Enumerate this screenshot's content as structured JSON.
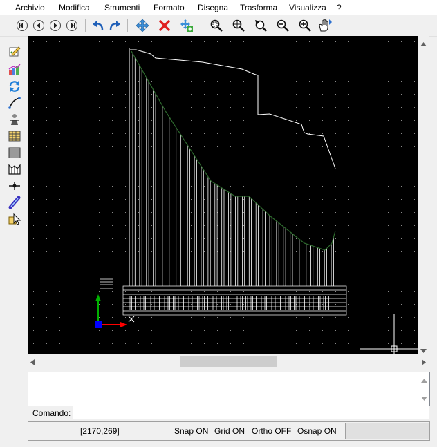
{
  "menu": [
    "Archivio",
    "Modifica",
    "Strumenti",
    "Formato",
    "Disegna",
    "Trasforma",
    "Visualizza",
    "?"
  ],
  "toolbar": {
    "icons": [
      "first-icon",
      "prev-icon",
      "next-icon",
      "last-icon",
      "undo-icon",
      "redo-icon",
      "move-icon",
      "delete-icon",
      "copy-move-icon",
      "zoom-window-icon",
      "zoom-extents-icon",
      "zoom-previous-icon",
      "zoom-out-icon",
      "zoom-in-icon",
      "pan-icon"
    ]
  },
  "sidebar": {
    "icons": [
      "edit-icon",
      "chart-icon",
      "refresh-icon",
      "curve-icon",
      "figure-icon",
      "table-icon",
      "list-icon",
      "section-icon",
      "point-icon",
      "ruler-icon",
      "pointer-icon"
    ]
  },
  "command": {
    "label": "Comando:",
    "value": ""
  },
  "status": {
    "coords": "[2170,269]",
    "snap": "Snap ON",
    "grid": "Grid ON",
    "ortho": "Ortho OFF",
    "osnap": "Osnap ON"
  },
  "colors": {
    "canvas": "#000000",
    "drawing": "#ffffff",
    "curve": "#2e6b2e",
    "axis_x": "#ff0000",
    "axis_y": "#00b000",
    "origin": "#0000ff"
  }
}
